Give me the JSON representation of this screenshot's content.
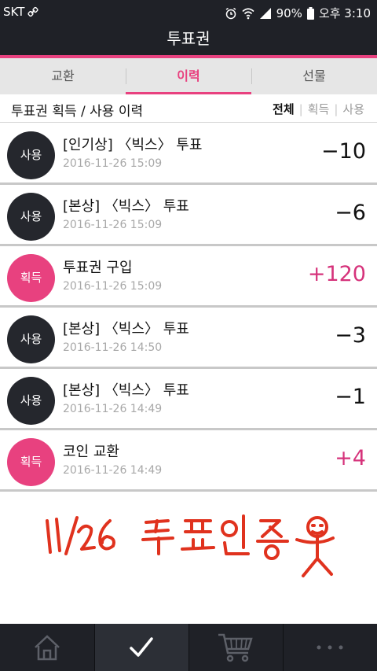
{
  "status_bar": {
    "carrier": "SKT",
    "battery": "90%",
    "time": "오후 3:10",
    "icons": [
      "link-icon",
      "alarm-icon",
      "wifi-icon",
      "signal-icon",
      "battery-icon"
    ]
  },
  "app_bar": {
    "title": "투표권"
  },
  "tabs": [
    {
      "label": "교환",
      "active": false
    },
    {
      "label": "이력",
      "active": true
    },
    {
      "label": "선물",
      "active": false
    }
  ],
  "section": {
    "title": "투표권 획득 / 사용 이력",
    "filters": [
      {
        "label": "전체",
        "active": true
      },
      {
        "label": "획득",
        "active": false
      },
      {
        "label": "사용",
        "active": false
      }
    ]
  },
  "history": [
    {
      "badge": "사용",
      "type": "use",
      "title": "[인기상] 〈빅스〉 투표",
      "time": "2016-11-26 15:09",
      "amount": "−10"
    },
    {
      "badge": "사용",
      "type": "use",
      "title": "[본상] 〈빅스〉 투표",
      "time": "2016-11-26 15:09",
      "amount": "−6"
    },
    {
      "badge": "획득",
      "type": "earn",
      "title": "투표권 구입",
      "time": "2016-11-26 15:09",
      "amount": "+120"
    },
    {
      "badge": "사용",
      "type": "use",
      "title": "[본상] 〈빅스〉 투표",
      "time": "2016-11-26 14:50",
      "amount": "−3"
    },
    {
      "badge": "사용",
      "type": "use",
      "title": "[본상] 〈빅스〉 투표",
      "time": "2016-11-26 14:49",
      "amount": "−1"
    },
    {
      "badge": "획득",
      "type": "earn",
      "title": "코인 교환",
      "time": "2016-11-26 14:49",
      "amount": "+4"
    }
  ],
  "handwriting": {
    "text": "11/26 투표인증",
    "color": "#e0321e"
  },
  "bottom_nav": [
    {
      "icon": "home-icon",
      "active": false
    },
    {
      "icon": "check-icon",
      "active": true
    },
    {
      "icon": "cart-icon",
      "active": false
    },
    {
      "icon": "more-icon",
      "active": false
    }
  ],
  "colors": {
    "accent": "#e8417f",
    "dark": "#1f2127",
    "use_badge": "#25272d",
    "earn_badge": "#e8417f"
  }
}
